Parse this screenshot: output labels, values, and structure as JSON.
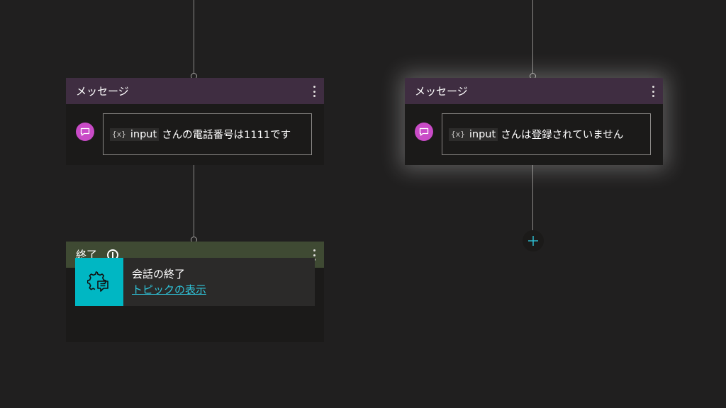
{
  "nodes": {
    "message_left": {
      "title": "メッセージ",
      "variable": "input",
      "variable_icon": "{x}",
      "text": "さんの電話番号は1111です"
    },
    "message_right": {
      "title": "メッセージ",
      "variable": "input",
      "variable_icon": "{x}",
      "text": "さんは登録されていません"
    },
    "end": {
      "title": "終了",
      "action_title": "会話の終了",
      "action_link": "トピックの表示"
    }
  },
  "icons": {
    "message": "chat-bubble-icon",
    "more": "more-vertical-icon",
    "info": "info-icon",
    "end_action": "gear-chat-icon",
    "add": "plus-icon"
  },
  "colors": {
    "canvas": "#201f1f",
    "message_header": "#3f2d41",
    "end_header": "#3f4a33",
    "message_icon": "#c94bc7",
    "end_icon": "#00b7c3",
    "link": "#2fc3d8"
  }
}
